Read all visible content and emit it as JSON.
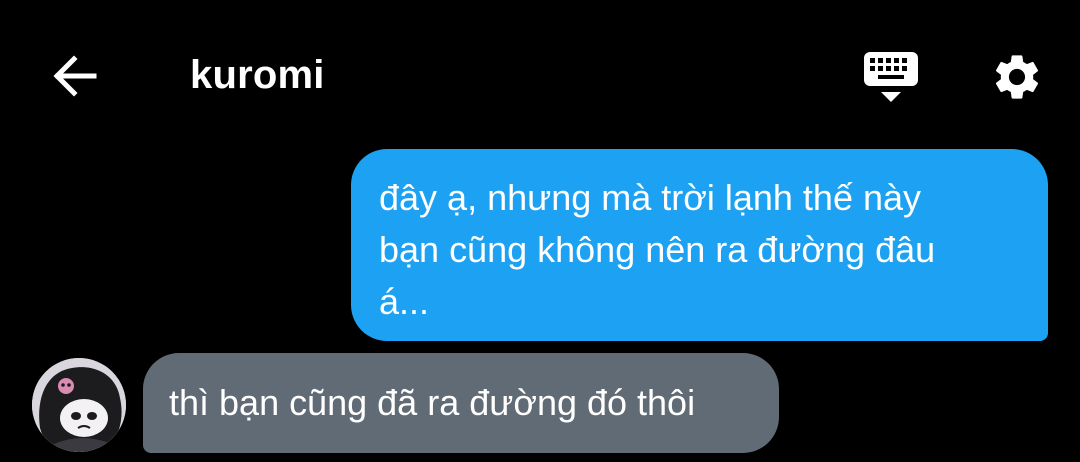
{
  "header": {
    "back_icon": "arrow-left-icon",
    "title": "kuromi",
    "keyboard_icon": "keyboard-icon",
    "settings_icon": "gear-icon"
  },
  "messages": [
    {
      "direction": "sent",
      "lines": [
        "đây ạ, nhưng mà trời lạnh thế này",
        "bạn cũng không nên ra đường đâu",
        "á..."
      ]
    },
    {
      "direction": "received",
      "text": "thì bạn cũng đã ra đường đó thôi",
      "avatar_icon": "kuromi-avatar"
    }
  ],
  "colors": {
    "background": "#000000",
    "sent_bubble": "#1da1f2",
    "received_bubble": "#616b75",
    "text": "#ffffff"
  }
}
